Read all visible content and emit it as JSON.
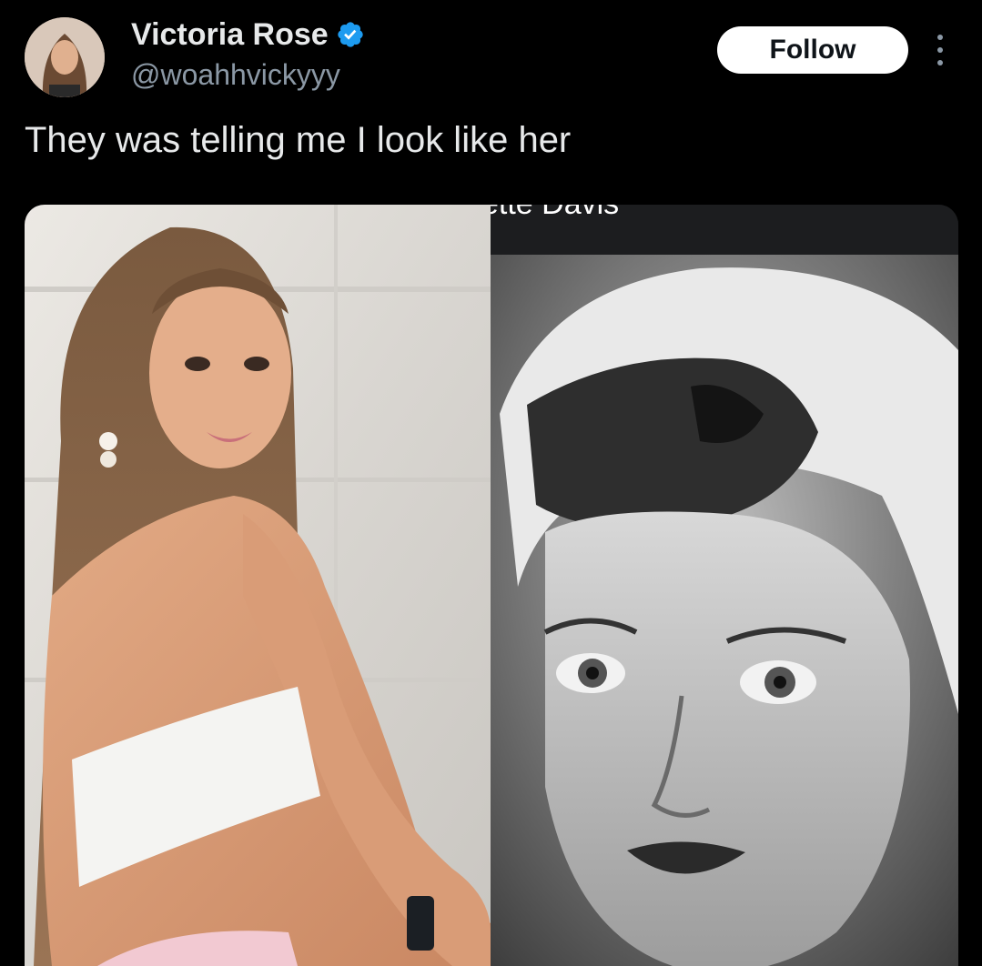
{
  "author": {
    "display_name": "Victoria Rose",
    "handle": "@woahhvickyyy",
    "verified": true,
    "avatar_icon": "profile-photo"
  },
  "actions": {
    "follow_label": "Follow",
    "more_icon": "more-options-icon"
  },
  "tweet": {
    "text": "They was telling me I look like her"
  },
  "media": {
    "right_caption": "ette Davis"
  },
  "colors": {
    "background": "#000000",
    "text_primary": "#e7e9ea",
    "text_secondary": "#8b98a5",
    "verified_blue": "#1d9bf0",
    "follow_bg": "#ffffff"
  }
}
